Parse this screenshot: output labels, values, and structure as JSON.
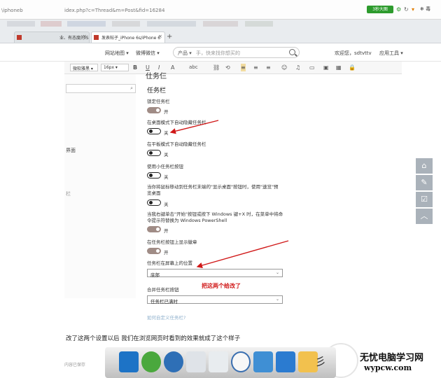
{
  "address_bar": {
    "url_left": "\\iphoneb",
    "url_right": "idex.php?c=Thread&m=Post&fid=16284",
    "speed_badge": "3秒大图",
    "right_text": "❄ 毒"
  },
  "tabs": [
    {
      "label": "业、有态度的IS",
      "active": false
    },
    {
      "label": "发表帖子_iPhone 6s/iPhone 6",
      "active": true
    }
  ],
  "site_header": {
    "nav": [
      "网站地图",
      "微博微信"
    ],
    "search_category": "产品",
    "search_placeholder": "手，快来找你想买的",
    "greeting": "欢迎您，sdtvttv",
    "app_tools": "应用工具"
  },
  "editor_toolbar": {
    "font_family": "微软雅黑",
    "font_size": "16px",
    "buttons": [
      "B",
      "U",
      "I",
      "A",
      "abc",
      "⛓",
      "⟲",
      "≡",
      "≡",
      "≡",
      "☺",
      "♫",
      "▭",
      "▣",
      "▦",
      "🔒"
    ]
  },
  "left_pane": {
    "labels": [
      "界面",
      "栏"
    ]
  },
  "settings": {
    "cropped_title": "仕务仨",
    "title": "任务栏",
    "items": [
      {
        "label": "锁定任务栏",
        "state": "on",
        "state_label": "开"
      },
      {
        "label": "在桌面模式下自动隐藏任务栏",
        "state": "off",
        "state_label": "关"
      },
      {
        "label": "在平板模式下自动隐藏任务栏",
        "state": "off",
        "state_label": "关"
      },
      {
        "label": "使用小任务栏按钮",
        "state": "off",
        "state_label": "关"
      },
      {
        "label_lines": [
          "当你将鼠标移动到任务栏末端的\"显示桌面\"按钮时，使用\"速览\"预",
          "览桌面"
        ],
        "state": "off",
        "state_label": "关"
      },
      {
        "label_lines": [
          "当我右键单击\"开始\"按钮或按下 Windows 键+X 时，在菜单中将命",
          "令提示符替换为 Windows PowerShell"
        ],
        "state": "on",
        "state_label": "开"
      },
      {
        "label": "在任务栏按钮上显示徽章",
        "state": "on",
        "state_label": "开"
      }
    ],
    "position_label": "任务栏在屏幕上的位置",
    "position_value": "底部",
    "annotation": "把这两个给改了",
    "combine_label": "合并任务栏按钮",
    "combine_value": "任务栏已满时",
    "custom_link": "如何自定义任务栏?"
  },
  "bottom_text": "改了这两个设置以后 我们在浏览网页时看到的效果就成了这个样子",
  "status_text": "内容已保存",
  "side_tools": [
    "home-icon",
    "edit-icon",
    "checklist-icon",
    "up-arrow-icon"
  ],
  "branding": {
    "line1": "无忧电脑学习网",
    "line2": "wypcw.com"
  },
  "colors": {
    "arrow_red": "#d01818",
    "toggle_on": "#a08c86",
    "side_tool_bg": "#aab2ba"
  }
}
